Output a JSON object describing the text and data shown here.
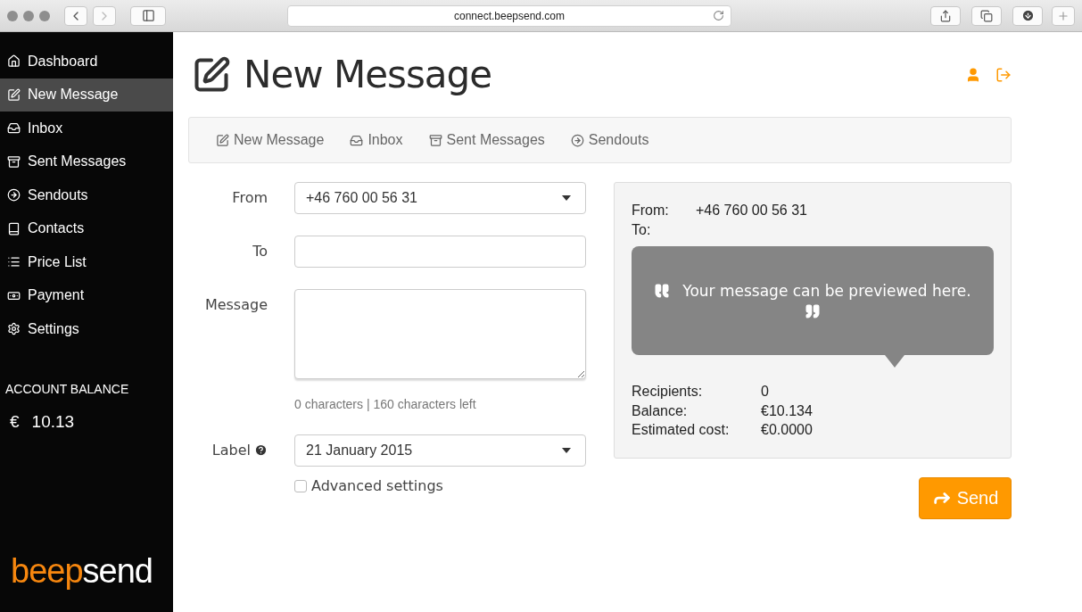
{
  "browser": {
    "url": "connect.beepsend.com"
  },
  "sidebar": {
    "items": [
      {
        "label": "Dashboard",
        "selected": false
      },
      {
        "label": "New Message",
        "selected": true
      },
      {
        "label": "Inbox",
        "selected": false
      },
      {
        "label": "Sent Messages",
        "selected": false
      },
      {
        "label": "Sendouts",
        "selected": false
      },
      {
        "label": "Contacts",
        "selected": false
      },
      {
        "label": "Price List",
        "selected": false
      },
      {
        "label": "Payment",
        "selected": false
      },
      {
        "label": "Settings",
        "selected": false
      }
    ],
    "balance_title": "ACCOUNT BALANCE",
    "balance_currency": "€",
    "balance_value": "10.13",
    "logo": [
      "beep",
      "send"
    ]
  },
  "header": {
    "title": "New Message"
  },
  "subnav": [
    "New Message",
    "Inbox",
    "Sent Messages",
    "Sendouts"
  ],
  "form": {
    "from_label": "From",
    "from_value": "+46 760 00 56 31",
    "to_label": "To",
    "message_label": "Message",
    "char_count": "0 characters | 160 characters left",
    "label_label": "Label",
    "label_value": "21 January 2015",
    "advanced": {
      "label": "Advanced settings",
      "checked": false
    }
  },
  "preview": {
    "from_label": "From:",
    "from_value": "+46 760 00 56 31",
    "to_label": "To:",
    "message": "Your message can be previewed here.",
    "stats": [
      {
        "label": "Recipients:",
        "value": "0"
      },
      {
        "label": "Balance:",
        "value": "€10.134"
      },
      {
        "label": "Estimated cost:",
        "value": "€0.0000"
      }
    ]
  },
  "send_button": "Send"
}
